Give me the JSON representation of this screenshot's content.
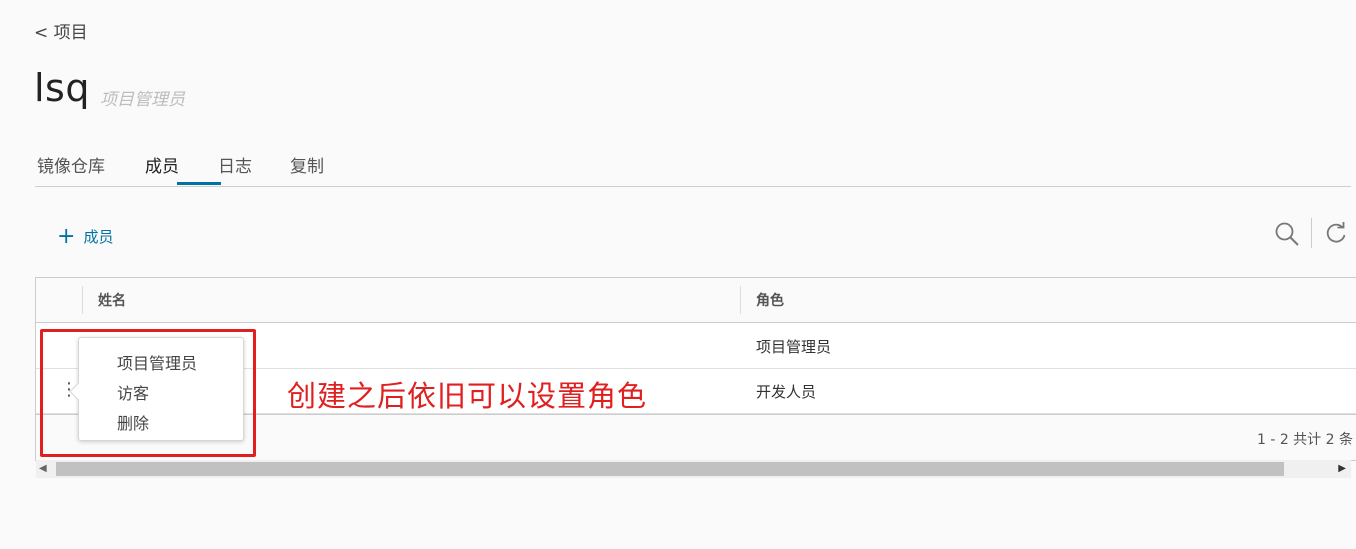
{
  "header": {
    "back_label": "< 项目",
    "project_name": "lsq",
    "role_label": "项目管理员"
  },
  "tabs": [
    {
      "label": "镜像仓库",
      "active": false
    },
    {
      "label": "成员",
      "active": true
    },
    {
      "label": "日志",
      "active": false
    },
    {
      "label": "复制",
      "active": false
    }
  ],
  "toolbar": {
    "add_member_label": "成员",
    "add_icon": "plus-icon",
    "search_icon": "search-icon",
    "refresh_icon": "refresh-icon"
  },
  "table": {
    "columns": [
      "姓名",
      "角色"
    ],
    "rows": [
      {
        "name": "",
        "role": "项目管理员"
      },
      {
        "name": "",
        "role": "开发人员"
      }
    ],
    "pagination": "1 - 2 共计 2 条"
  },
  "action_menu": {
    "items": [
      "项目管理员",
      "访客",
      "删除"
    ]
  },
  "annotation": {
    "text": "创建之后依旧可以设置角色",
    "color": "#e02020"
  },
  "colors": {
    "accent": "#0072a3",
    "annotation": "#e02020"
  }
}
